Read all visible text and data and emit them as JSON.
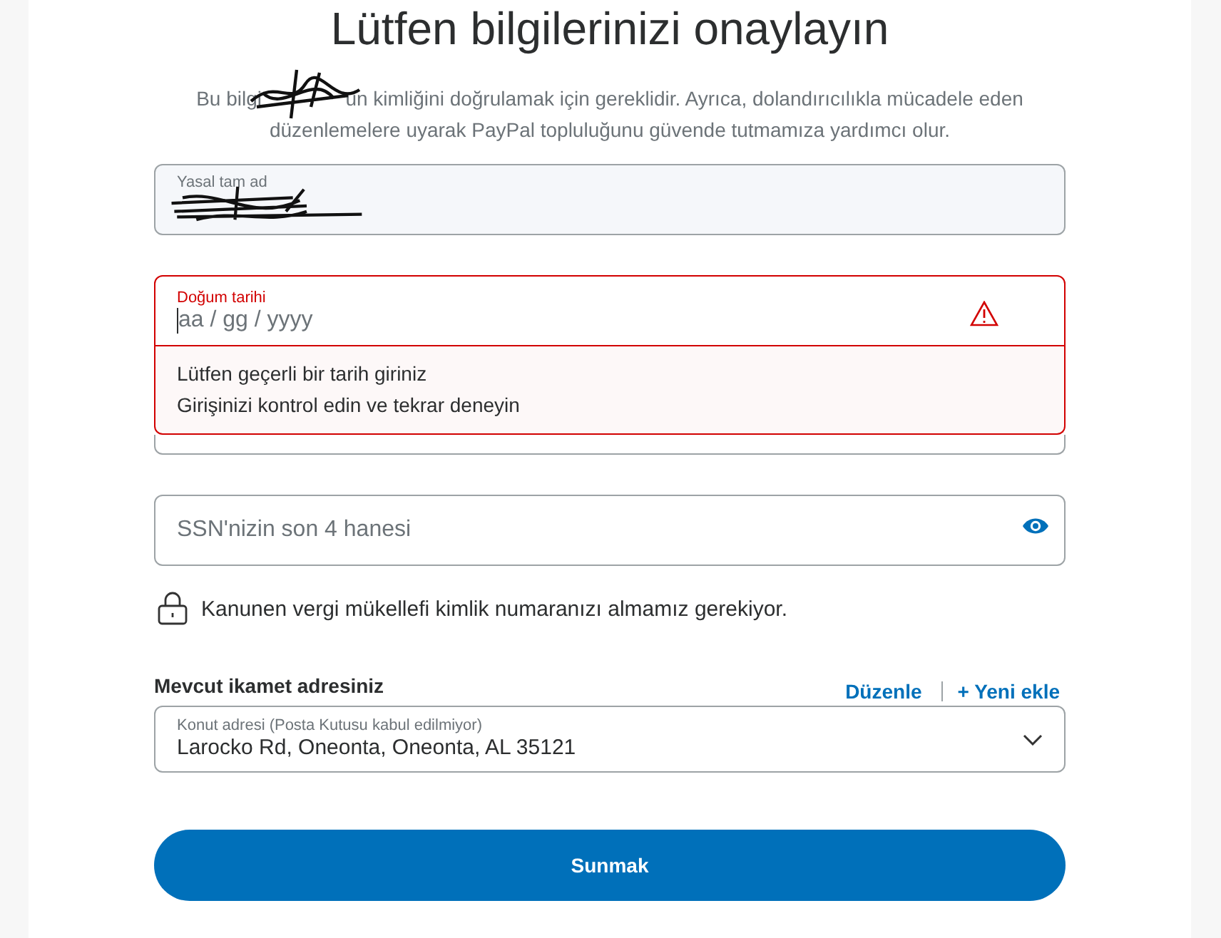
{
  "title": "Lütfen bilgilerinizi onaylayın",
  "intro": {
    "before": "Bu bilgi",
    "after": "'un kimliğini doğrulamak için gereklidir. Ayrıca, dolandırıcılıkla mücadele eden",
    "line2": "düzenlemelere uyarak PayPal topluluğunu güvende tutmamıza yardımcı olur."
  },
  "fields": [
    {
      "kind": "redacted",
      "label": "Yasal tam ad"
    },
    {
      "kind": "date",
      "label": "Doğum tarihi",
      "placeholder": "aa / gg / yyyy",
      "error": true,
      "messages": [
        "Lütfen geçerli bir tarih giriniz",
        "Girişinizi kontrol edin ve tekrar deneyin"
      ]
    },
    {
      "kind": "covered"
    },
    {
      "kind": "secret",
      "placeholder": "SSN'nizin son 4 hanesi"
    }
  ],
  "notice": "Kanunen vergi mükellefi kimlik numaranızı almamız gerekiyor.",
  "address": {
    "heading": "Mevcut ikamet adresiniz",
    "links": [
      "Düzenle",
      "+ Yeni ekle"
    ],
    "label": "Konut adresi (Posta Kutusu kabul edilmiyor)",
    "value": "Larocko Rd, Oneonta, Oneonta, AL 35121"
  },
  "submit": "Sunmak"
}
